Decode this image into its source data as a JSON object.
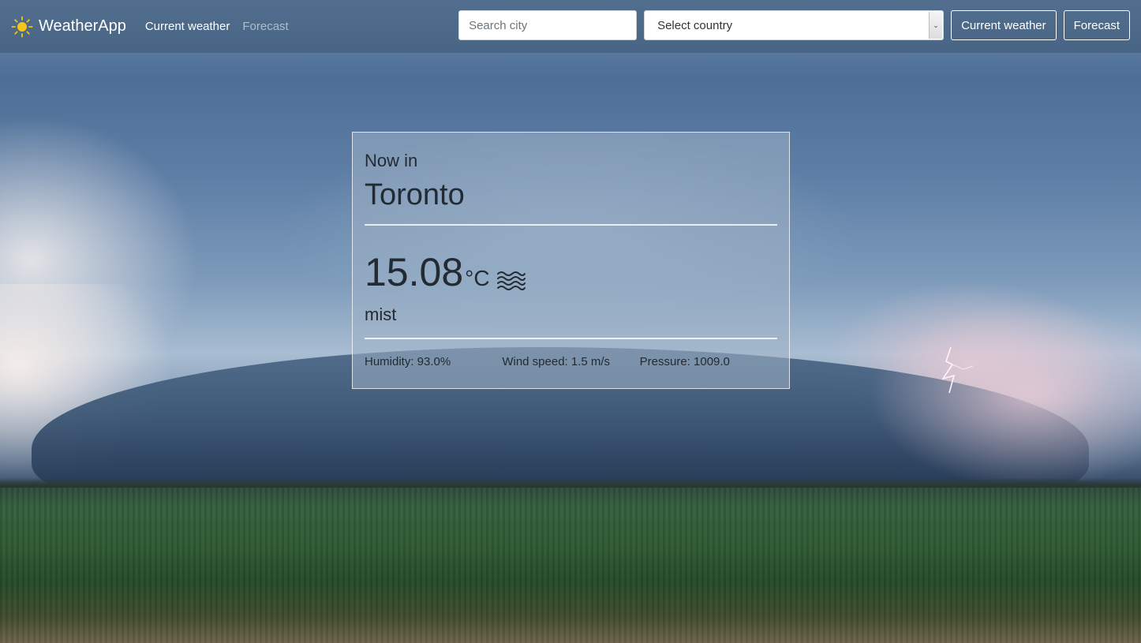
{
  "navbar": {
    "brand": "WeatherApp",
    "brand_icon": "sun-icon",
    "links": {
      "current": "Current weather",
      "forecast": "Forecast"
    },
    "search": {
      "placeholder": "Search city",
      "value": ""
    },
    "country_select": {
      "value": "Select country"
    },
    "buttons": {
      "current": "Current weather",
      "forecast": "Forecast"
    }
  },
  "weather_card": {
    "now_in_label": "Now in",
    "city": "Toronto",
    "temperature": "15.08",
    "unit": "°C",
    "condition_icon": "mist-icon",
    "description": "mist",
    "humidity": "Humidity: 93.0%",
    "wind_speed": "Wind speed: 1.5 m/s",
    "pressure": "Pressure: 1009.0"
  },
  "colors": {
    "sun": "#f5c518",
    "nav_bg": "#3c5573",
    "card_text": "#222a33"
  }
}
